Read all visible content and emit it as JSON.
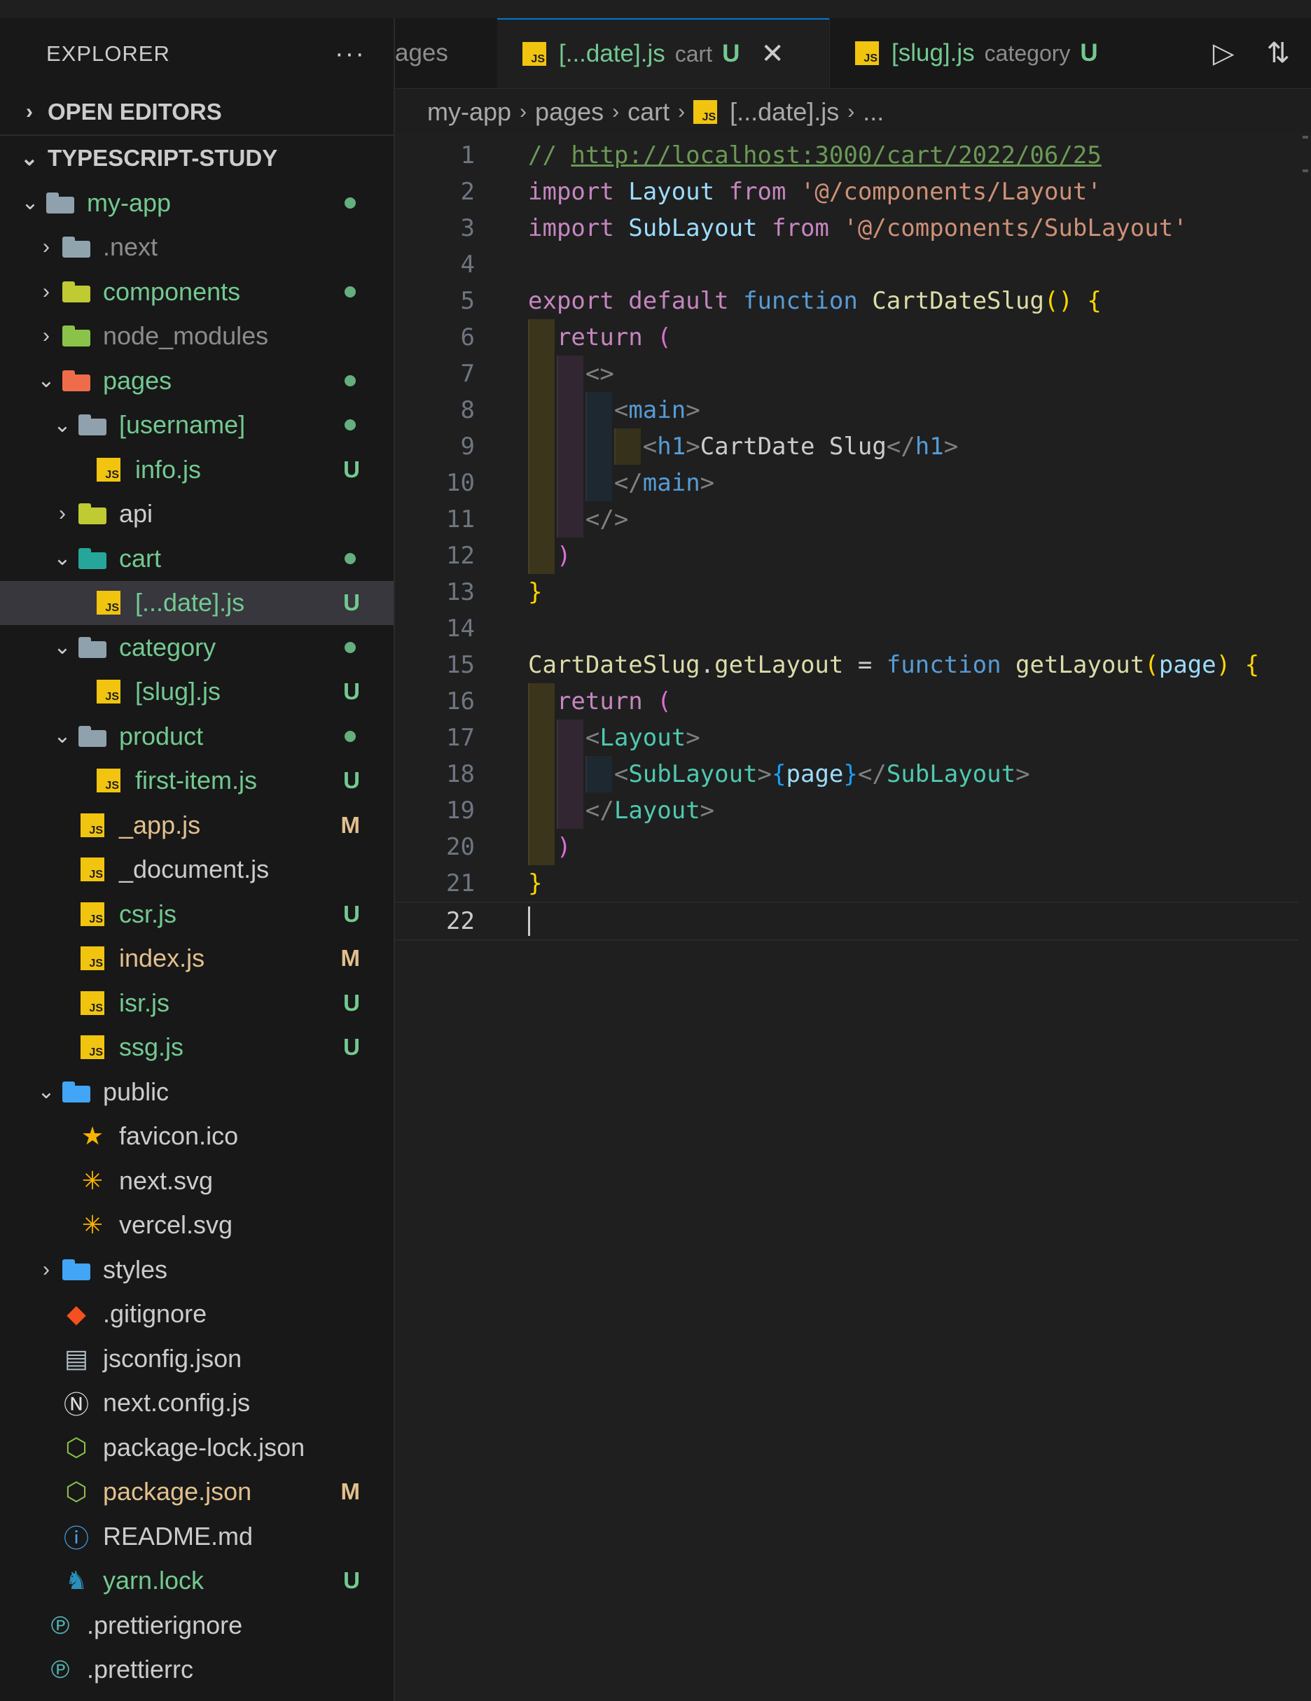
{
  "sidebar": {
    "title": "EXPLORER",
    "more": "···",
    "open_editors": "OPEN EDITORS",
    "project": "TYPESCRIPT-STUDY",
    "items": [
      {
        "label": "my-app",
        "indent": 1,
        "chev": "open",
        "icon": "folder-grey",
        "color": "green",
        "dot": true
      },
      {
        "label": ".next",
        "indent": 2,
        "chev": "closed",
        "icon": "folder-next",
        "color": "grey"
      },
      {
        "label": "components",
        "indent": 2,
        "chev": "closed",
        "icon": "folder-yellow",
        "color": "green",
        "dot": true
      },
      {
        "label": "node_modules",
        "indent": 2,
        "chev": "closed",
        "icon": "folder-green",
        "color": "grey"
      },
      {
        "label": "pages",
        "indent": 2,
        "chev": "open",
        "icon": "folder-red",
        "color": "green",
        "dot": true
      },
      {
        "label": "[username]",
        "indent": 3,
        "chev": "open",
        "icon": "folder-grey",
        "color": "green",
        "dot": true
      },
      {
        "label": "info.js",
        "indent": 4,
        "icon": "js",
        "color": "green",
        "badge": "U"
      },
      {
        "label": "api",
        "indent": 3,
        "chev": "closed",
        "icon": "folder-yellow",
        "color": "white"
      },
      {
        "label": "cart",
        "indent": 3,
        "chev": "open",
        "icon": "folder-teal",
        "color": "green",
        "dot": true
      },
      {
        "label": "[...date].js",
        "indent": 4,
        "icon": "js",
        "color": "green",
        "badge": "U",
        "selected": true
      },
      {
        "label": "category",
        "indent": 3,
        "chev": "open",
        "icon": "folder-grey",
        "color": "green",
        "dot": true
      },
      {
        "label": "[slug].js",
        "indent": 4,
        "icon": "js",
        "color": "green",
        "badge": "U"
      },
      {
        "label": "product",
        "indent": 3,
        "chev": "open",
        "icon": "folder-grey",
        "color": "green",
        "dot": true
      },
      {
        "label": "first-item.js",
        "indent": 4,
        "icon": "js",
        "color": "green",
        "badge": "U"
      },
      {
        "label": "_app.js",
        "indent": 3,
        "icon": "js",
        "color": "yellow",
        "badge": "M"
      },
      {
        "label": "_document.js",
        "indent": 3,
        "icon": "js",
        "color": "white"
      },
      {
        "label": "csr.js",
        "indent": 3,
        "icon": "js",
        "color": "green",
        "badge": "U"
      },
      {
        "label": "index.js",
        "indent": 3,
        "icon": "js",
        "color": "yellow",
        "badge": "M"
      },
      {
        "label": "isr.js",
        "indent": 3,
        "icon": "js",
        "color": "green",
        "badge": "U"
      },
      {
        "label": "ssg.js",
        "indent": 3,
        "icon": "js",
        "color": "green",
        "badge": "U"
      },
      {
        "label": "public",
        "indent": 2,
        "chev": "open",
        "icon": "folder-blue",
        "color": "white"
      },
      {
        "label": "favicon.ico",
        "indent": 3,
        "icon": "star",
        "color": "white"
      },
      {
        "label": "next.svg",
        "indent": 3,
        "icon": "svg",
        "color": "white"
      },
      {
        "label": "vercel.svg",
        "indent": 3,
        "icon": "svg",
        "color": "white"
      },
      {
        "label": "styles",
        "indent": 2,
        "chev": "closed",
        "icon": "folder-blue",
        "color": "white"
      },
      {
        "label": ".gitignore",
        "indent": 2,
        "icon": "git",
        "color": "white"
      },
      {
        "label": "jsconfig.json",
        "indent": 2,
        "icon": "jsconfig",
        "color": "white"
      },
      {
        "label": "next.config.js",
        "indent": 2,
        "icon": "next",
        "color": "white"
      },
      {
        "label": "package-lock.json",
        "indent": 2,
        "icon": "node",
        "color": "white"
      },
      {
        "label": "package.json",
        "indent": 2,
        "icon": "node",
        "color": "yellow",
        "badge": "M"
      },
      {
        "label": "README.md",
        "indent": 2,
        "icon": "info",
        "color": "white"
      },
      {
        "label": "yarn.lock",
        "indent": 2,
        "icon": "yarn",
        "color": "green",
        "badge": "U"
      },
      {
        "label": ".prettierignore",
        "indent": 1,
        "icon": "prettier",
        "color": "white"
      },
      {
        "label": ".prettierrc",
        "indent": 1,
        "icon": "prettier",
        "color": "white"
      }
    ]
  },
  "tabs": {
    "partial_label": "ages",
    "active": {
      "name": "[...date].js",
      "desc": "cart",
      "status": "U",
      "close": "✕"
    },
    "other": {
      "name": "[slug].js",
      "desc": "category",
      "status": "U"
    },
    "run_icon": "▷",
    "compare_icon": "⇅"
  },
  "breadcrumb": [
    "my-app",
    "pages",
    "cart",
    "[...date].js",
    "..."
  ],
  "editor": {
    "current_line": 22,
    "lines": [
      [
        [
          "// ",
          "com"
        ],
        [
          "http://localhost:3000/cart/2022/06/25",
          "url"
        ]
      ],
      [
        [
          "import ",
          "kw"
        ],
        [
          "Layout ",
          "var"
        ],
        [
          "from ",
          "kw"
        ],
        [
          "'@/components/Layout'",
          "str"
        ]
      ],
      [
        [
          "import ",
          "kw"
        ],
        [
          "SubLayout ",
          "var"
        ],
        [
          "from ",
          "kw"
        ],
        [
          "'@/components/SubLayout'",
          "str"
        ]
      ],
      [],
      [
        [
          "export ",
          "kw"
        ],
        [
          "default ",
          "kw"
        ],
        [
          "function ",
          "blue"
        ],
        [
          "CartDateSlug",
          "fn"
        ],
        [
          "() ",
          "br1"
        ],
        [
          "{",
          "br1"
        ]
      ],
      [
        [
          "  ",
          ""
        ],
        [
          "return ",
          "kw"
        ],
        [
          "(",
          "br2"
        ]
      ],
      [
        [
          "    ",
          ""
        ],
        [
          "<>",
          "gray"
        ]
      ],
      [
        [
          "      ",
          ""
        ],
        [
          "<",
          "gray"
        ],
        [
          "main",
          "tag"
        ],
        [
          ">",
          "gray"
        ]
      ],
      [
        [
          "        ",
          ""
        ],
        [
          "<",
          "gray"
        ],
        [
          "h1",
          "tag"
        ],
        [
          ">",
          "gray"
        ],
        [
          "CartDate Slug",
          ""
        ],
        [
          "</",
          "gray"
        ],
        [
          "h1",
          "tag"
        ],
        [
          ">",
          "gray"
        ]
      ],
      [
        [
          "      ",
          ""
        ],
        [
          "</",
          "gray"
        ],
        [
          "main",
          "tag"
        ],
        [
          ">",
          "gray"
        ]
      ],
      [
        [
          "    ",
          ""
        ],
        [
          "</>",
          "gray"
        ]
      ],
      [
        [
          "  ",
          ""
        ],
        [
          ")",
          "br2"
        ]
      ],
      [
        [
          "}",
          "br1"
        ]
      ],
      [],
      [
        [
          "CartDateSlug",
          "fn"
        ],
        [
          ".",
          ""
        ],
        [
          "getLayout ",
          "fn"
        ],
        [
          "= ",
          ""
        ],
        [
          "function ",
          "blue"
        ],
        [
          "getLayout",
          "fn"
        ],
        [
          "(",
          "br1"
        ],
        [
          "page",
          "var"
        ],
        [
          ") ",
          "br1"
        ],
        [
          "{",
          "br1"
        ]
      ],
      [
        [
          "  ",
          ""
        ],
        [
          "return ",
          "kw"
        ],
        [
          "(",
          "br2"
        ]
      ],
      [
        [
          "    ",
          ""
        ],
        [
          "<",
          "gray"
        ],
        [
          "Layout",
          "comp"
        ],
        [
          ">",
          "gray"
        ]
      ],
      [
        [
          "      ",
          ""
        ],
        [
          "<",
          "gray"
        ],
        [
          "SubLayout",
          "comp"
        ],
        [
          ">",
          "gray"
        ],
        [
          "{",
          "br3"
        ],
        [
          "page",
          "var"
        ],
        [
          "}",
          "br3"
        ],
        [
          "</",
          "gray"
        ],
        [
          "SubLayout",
          "comp"
        ],
        [
          ">",
          "gray"
        ]
      ],
      [
        [
          "    ",
          ""
        ],
        [
          "</",
          "gray"
        ],
        [
          "Layout",
          "comp"
        ],
        [
          ">",
          "gray"
        ]
      ],
      [
        [
          "  ",
          ""
        ],
        [
          ")",
          "br2"
        ]
      ],
      [
        [
          "}",
          "br1"
        ]
      ],
      []
    ]
  },
  "colors": {
    "accent": "#0078d4",
    "git_untracked": "#73c991",
    "git_modified": "#e2c08d"
  }
}
